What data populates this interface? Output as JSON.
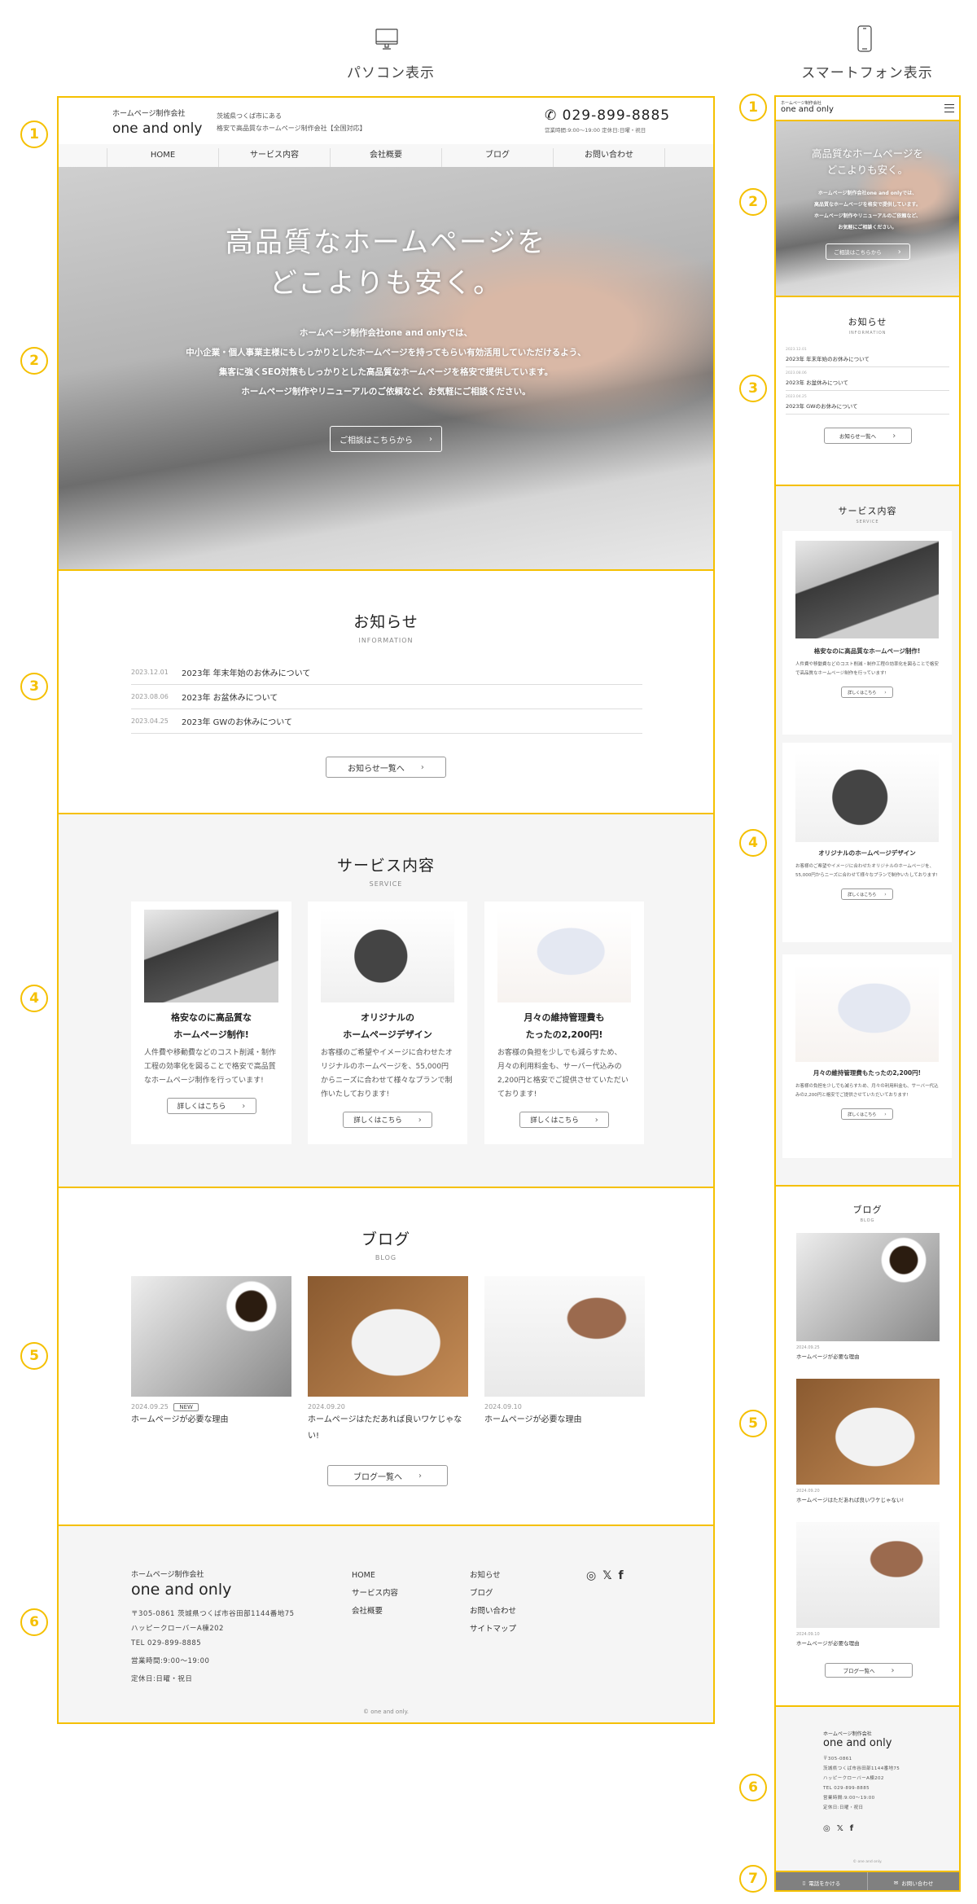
{
  "labels": {
    "pc": "パソコン表示",
    "sp": "スマートフォン表示",
    "numbers": [
      "1",
      "2",
      "3",
      "4",
      "5",
      "6",
      "7"
    ]
  },
  "brand": {
    "company": "ホームページ制作会社",
    "name": "one and only",
    "tagline1": "茨城県つくば市にある",
    "tagline2": "格安で高品質なホームページ制作会社【全国対応】",
    "phone": "029-899-8885",
    "hours": "営業時間:9:00～19:00 定休日:日曜・祝日"
  },
  "nav": [
    "HOME",
    "サービス内容",
    "会社概要",
    "ブログ",
    "お問い合わせ"
  ],
  "hero": {
    "title1": "高品質なホームページを",
    "title2": "どこよりも安く。",
    "pc_lines": [
      "ホームページ制作会社one and onlyでは、",
      "中小企業・個人事業主様にもしっかりとしたホームページを持ってもらい有効活用していただけるよう、",
      "集客に強くSEO対策もしっかりとした高品質なホームページを格安で提供しています。",
      "ホームページ制作やリニューアルのご依頼など、お気軽にご相談ください。"
    ],
    "sp_lines": [
      "ホームページ制作会社one and onlyでは、",
      "高品質なホームページを格安で提供しています。",
      "ホームページ制作やリニューアルのご依頼など、",
      "お気軽にご相談ください。"
    ],
    "cta": "ご相談はこちらから"
  },
  "info": {
    "title": "お知らせ",
    "sub": "INFORMATION",
    "items": [
      {
        "date": "2023.12.01",
        "title": "2023年 年末年始のお休みについて"
      },
      {
        "date": "2023.08.06",
        "title": "2023年 お盆休みについて"
      },
      {
        "date": "2023.04.25",
        "title": "2023年 GWのお休みについて"
      }
    ],
    "button": "お知らせ一覧へ"
  },
  "service": {
    "title": "サービス内容",
    "sub": "SERVICE",
    "button": "詳しくはこちら",
    "items": [
      {
        "t1": "格安なのに高品質な",
        "t2": "ホームページ制作!",
        "text": "人件費や移動費などのコスト削減・制作工程の効率化を図ることで格安で高品質なホームページ制作を行っています!"
      },
      {
        "t1": "オリジナルの",
        "t2": "ホームページデザイン",
        "text": "お客様のご希望やイメージに合わせたオリジナルのホームページを、55,000円からニーズに合わせて様々なプランで制作いたしております!"
      },
      {
        "t1": "月々の維持管理費も",
        "t2": "たったの2,200円!",
        "text": "お客様の負担を少しでも減らすため、月々の利用料金も、サーバー代込みの2,200円と格安でご提供させていただいております!"
      }
    ]
  },
  "blog": {
    "title": "ブログ",
    "sub": "BLOG",
    "button": "ブログ一覧へ",
    "new_badge": "NEW",
    "items": [
      {
        "date": "2024.09.25",
        "title": "ホームページが必要な理由"
      },
      {
        "date": "2024.09.20",
        "title": "ホームページはただあれば良いワケじゃない!"
      },
      {
        "date": "2024.09.10",
        "title": "ホームページが必要な理由"
      }
    ]
  },
  "footer": {
    "address1": "〒305-0861 茨城県つくば市谷田部1144番地75",
    "zip": "〒305-0861",
    "address_sp": "茨城県つくば市谷田部1144番地75",
    "address2": "ハッピークローバーA棟202",
    "tel": "TEL 029-899-8885",
    "hours": "営業時間:9:00～19:00",
    "closed": "定休日:日曜・祝日",
    "nav1": [
      "HOME",
      "サービス内容",
      "会社概要"
    ],
    "nav2": [
      "お知らせ",
      "ブログ",
      "お問い合わせ",
      "サイトマップ"
    ],
    "social": [
      "instagram-icon",
      "x-icon",
      "facebook-icon"
    ],
    "copyright": "© one and only."
  },
  "sp_bar": {
    "call": "電話をかける",
    "contact": "お問い合わせ"
  },
  "colors": {
    "accent": "#f5c000",
    "footer_bg": "#f5f5f5",
    "bar_bg": "#808080"
  }
}
